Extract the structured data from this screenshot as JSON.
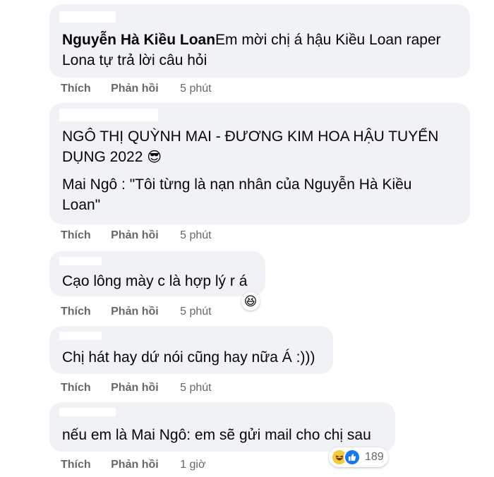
{
  "comments": [
    {
      "author": "Nguyễn Hà Kiều Loan",
      "text_line1": "Em mời chị á hậu Kiều Loan raper",
      "text_line2": "Lona tự trả lời câu hỏi",
      "like": "Thích",
      "reply": "Phản hồi",
      "time": "5 phút"
    },
    {
      "line1": "NGÔ THỊ QUỲNH MAI - ĐƯƠNG KIM HOA HẬU TUYỂN",
      "line2": "DỤNG 2022",
      "line2_emoji": "😎",
      "line3": "Mai Ngô : \"Tôi từng là nạn nhân của Nguyễn Hà Kiều",
      "line4": "Loan\"",
      "like": "Thích",
      "reply": "Phản hồi",
      "time": "5 phút"
    },
    {
      "text": "Cạo lông mày c là hợp lý r á",
      "reaction_emoji": "😆",
      "like": "Thích",
      "reply": "Phản hồi",
      "time": "5 phút"
    },
    {
      "text": "Chị hát hay dứ nói cũng hay nữa Á :)))",
      "like": "Thích",
      "reply": "Phản hồi",
      "time": "5 phút"
    },
    {
      "text": "nếu em là Mai Ngô: em sẽ gửi mail cho chị sau",
      "reaction_count": "189",
      "like": "Thích",
      "reply": "Phản hồi",
      "time": "1 giờ"
    }
  ]
}
